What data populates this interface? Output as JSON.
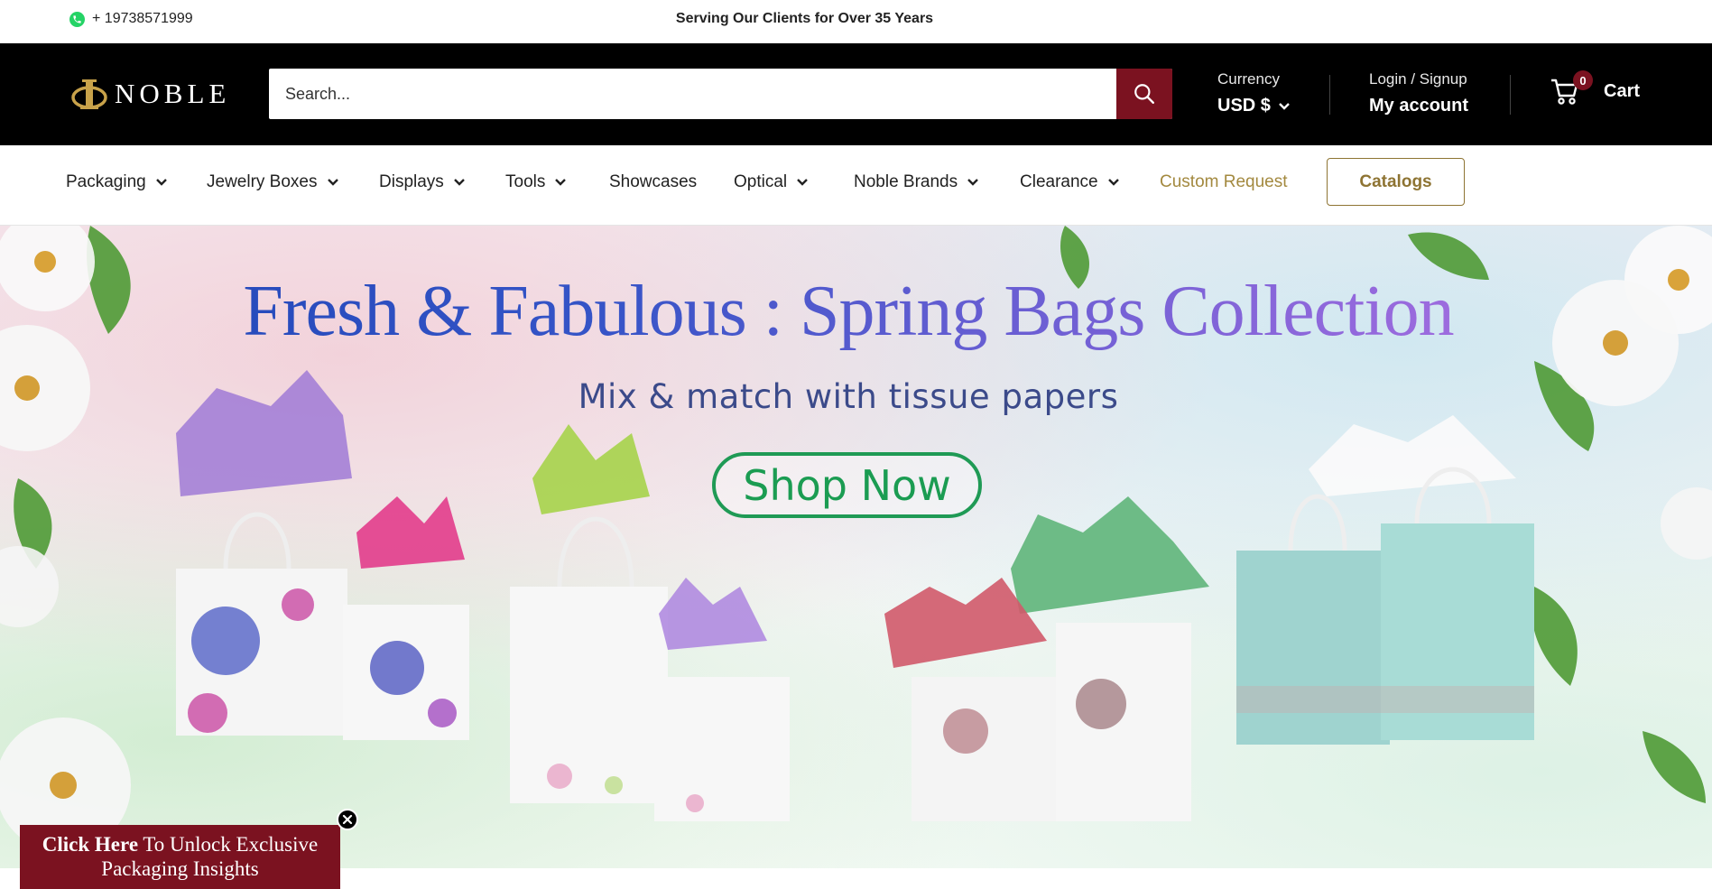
{
  "topbar": {
    "phone": "+ 19738571999",
    "tagline": "Serving Our Clients for Over 35 Years"
  },
  "header": {
    "logo_text": "NOBLE",
    "search_placeholder": "Search...",
    "currency_label": "Currency",
    "currency_value": "USD $",
    "login_label": "Login / Signup",
    "account_label": "My account",
    "cart_count": "0",
    "cart_label": "Cart"
  },
  "nav": {
    "items": [
      {
        "label": "Packaging"
      },
      {
        "label": "Jewelry Boxes"
      },
      {
        "label": "Displays"
      },
      {
        "label": "Tools"
      },
      {
        "label": "Showcases"
      },
      {
        "label": "Optical"
      },
      {
        "label": "Noble Brands"
      },
      {
        "label": "Clearance"
      },
      {
        "label": "Custom Request"
      }
    ],
    "catalogs_label": "Catalogs"
  },
  "hero": {
    "title": "Fresh & Fabulous : Spring Bags Collection",
    "subtitle": "Mix & match with tissue papers",
    "cta": "Shop Now"
  },
  "promo": {
    "bold": "Click Here",
    "text": " To Unlock Exclusive Packaging Insights"
  },
  "colors": {
    "brand": "#7b1220",
    "gold": "#8e7433",
    "cta_green": "#1f9a55"
  }
}
